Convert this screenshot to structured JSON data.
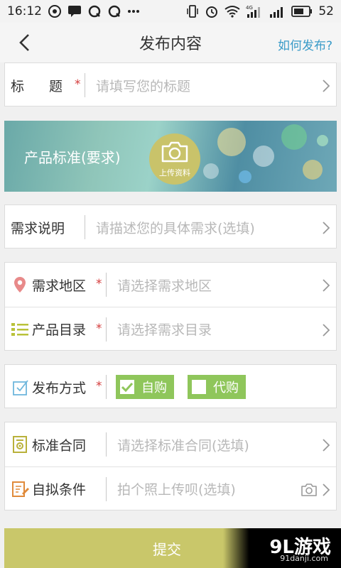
{
  "status_bar": {
    "time": "16:12",
    "battery": "52",
    "network": "4G"
  },
  "header": {
    "title": "发布内容",
    "help_label": "如何发布?"
  },
  "form": {
    "title_field": {
      "label": "标　题",
      "required": "*",
      "placeholder": "请填写您的标题"
    },
    "banner": {
      "label": "产品标准(要求)",
      "upload_label": "上传资料"
    },
    "requirement": {
      "label": "需求说明",
      "placeholder": "请描述您的具体需求(选填)"
    },
    "region": {
      "label": "需求地区",
      "required": "*",
      "placeholder": "请选择需求地区"
    },
    "catalog": {
      "label": "产品目录",
      "required": "*",
      "placeholder": "请选择需求目录"
    },
    "method": {
      "label": "发布方式",
      "required": "*",
      "options": [
        {
          "label": "自购",
          "checked": true
        },
        {
          "label": "代购",
          "checked": false
        }
      ]
    },
    "contract": {
      "label": "标准合同",
      "placeholder": "请选择标准合同(选填)"
    },
    "conditions": {
      "label": "自拟条件",
      "placeholder": "拍个照上传呗(选填)"
    }
  },
  "submit_label": "提交",
  "watermark": {
    "logo": "9L游戏",
    "site": "91danji.com"
  },
  "colors": {
    "accent_green": "#8fc65b",
    "submit_yellow": "#c9c76a",
    "required_red": "#d43c3c",
    "link_blue": "#3a9bc8"
  },
  "icons": [
    "back-icon",
    "location-pin-icon",
    "list-icon",
    "checkbox-icon",
    "contract-icon",
    "edit-icon",
    "camera-icon",
    "chevron-right-icon"
  ]
}
